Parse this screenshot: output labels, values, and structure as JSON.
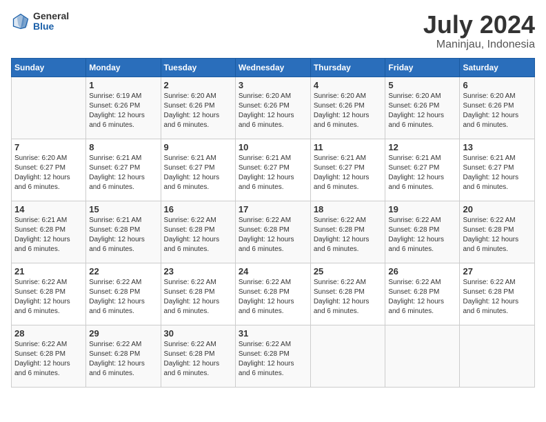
{
  "header": {
    "logo_general": "General",
    "logo_blue": "Blue",
    "month_year": "July 2024",
    "location": "Maninjau, Indonesia"
  },
  "days_of_week": [
    "Sunday",
    "Monday",
    "Tuesday",
    "Wednesday",
    "Thursday",
    "Friday",
    "Saturday"
  ],
  "weeks": [
    [
      {
        "day": "",
        "info": ""
      },
      {
        "day": "1",
        "info": "Sunrise: 6:19 AM\nSunset: 6:26 PM\nDaylight: 12 hours\nand 6 minutes."
      },
      {
        "day": "2",
        "info": "Sunrise: 6:20 AM\nSunset: 6:26 PM\nDaylight: 12 hours\nand 6 minutes."
      },
      {
        "day": "3",
        "info": "Sunrise: 6:20 AM\nSunset: 6:26 PM\nDaylight: 12 hours\nand 6 minutes."
      },
      {
        "day": "4",
        "info": "Sunrise: 6:20 AM\nSunset: 6:26 PM\nDaylight: 12 hours\nand 6 minutes."
      },
      {
        "day": "5",
        "info": "Sunrise: 6:20 AM\nSunset: 6:26 PM\nDaylight: 12 hours\nand 6 minutes."
      },
      {
        "day": "6",
        "info": "Sunrise: 6:20 AM\nSunset: 6:26 PM\nDaylight: 12 hours\nand 6 minutes."
      }
    ],
    [
      {
        "day": "7",
        "info": "Sunrise: 6:20 AM\nSunset: 6:27 PM\nDaylight: 12 hours\nand 6 minutes."
      },
      {
        "day": "8",
        "info": "Sunrise: 6:21 AM\nSunset: 6:27 PM\nDaylight: 12 hours\nand 6 minutes."
      },
      {
        "day": "9",
        "info": "Sunrise: 6:21 AM\nSunset: 6:27 PM\nDaylight: 12 hours\nand 6 minutes."
      },
      {
        "day": "10",
        "info": "Sunrise: 6:21 AM\nSunset: 6:27 PM\nDaylight: 12 hours\nand 6 minutes."
      },
      {
        "day": "11",
        "info": "Sunrise: 6:21 AM\nSunset: 6:27 PM\nDaylight: 12 hours\nand 6 minutes."
      },
      {
        "day": "12",
        "info": "Sunrise: 6:21 AM\nSunset: 6:27 PM\nDaylight: 12 hours\nand 6 minutes."
      },
      {
        "day": "13",
        "info": "Sunrise: 6:21 AM\nSunset: 6:27 PM\nDaylight: 12 hours\nand 6 minutes."
      }
    ],
    [
      {
        "day": "14",
        "info": "Sunrise: 6:21 AM\nSunset: 6:28 PM\nDaylight: 12 hours\nand 6 minutes."
      },
      {
        "day": "15",
        "info": "Sunrise: 6:21 AM\nSunset: 6:28 PM\nDaylight: 12 hours\nand 6 minutes."
      },
      {
        "day": "16",
        "info": "Sunrise: 6:22 AM\nSunset: 6:28 PM\nDaylight: 12 hours\nand 6 minutes."
      },
      {
        "day": "17",
        "info": "Sunrise: 6:22 AM\nSunset: 6:28 PM\nDaylight: 12 hours\nand 6 minutes."
      },
      {
        "day": "18",
        "info": "Sunrise: 6:22 AM\nSunset: 6:28 PM\nDaylight: 12 hours\nand 6 minutes."
      },
      {
        "day": "19",
        "info": "Sunrise: 6:22 AM\nSunset: 6:28 PM\nDaylight: 12 hours\nand 6 minutes."
      },
      {
        "day": "20",
        "info": "Sunrise: 6:22 AM\nSunset: 6:28 PM\nDaylight: 12 hours\nand 6 minutes."
      }
    ],
    [
      {
        "day": "21",
        "info": "Sunrise: 6:22 AM\nSunset: 6:28 PM\nDaylight: 12 hours\nand 6 minutes."
      },
      {
        "day": "22",
        "info": "Sunrise: 6:22 AM\nSunset: 6:28 PM\nDaylight: 12 hours\nand 6 minutes."
      },
      {
        "day": "23",
        "info": "Sunrise: 6:22 AM\nSunset: 6:28 PM\nDaylight: 12 hours\nand 6 minutes."
      },
      {
        "day": "24",
        "info": "Sunrise: 6:22 AM\nSunset: 6:28 PM\nDaylight: 12 hours\nand 6 minutes."
      },
      {
        "day": "25",
        "info": "Sunrise: 6:22 AM\nSunset: 6:28 PM\nDaylight: 12 hours\nand 6 minutes."
      },
      {
        "day": "26",
        "info": "Sunrise: 6:22 AM\nSunset: 6:28 PM\nDaylight: 12 hours\nand 6 minutes."
      },
      {
        "day": "27",
        "info": "Sunrise: 6:22 AM\nSunset: 6:28 PM\nDaylight: 12 hours\nand 6 minutes."
      }
    ],
    [
      {
        "day": "28",
        "info": "Sunrise: 6:22 AM\nSunset: 6:28 PM\nDaylight: 12 hours\nand 6 minutes."
      },
      {
        "day": "29",
        "info": "Sunrise: 6:22 AM\nSunset: 6:28 PM\nDaylight: 12 hours\nand 6 minutes."
      },
      {
        "day": "30",
        "info": "Sunrise: 6:22 AM\nSunset: 6:28 PM\nDaylight: 12 hours\nand 6 minutes."
      },
      {
        "day": "31",
        "info": "Sunrise: 6:22 AM\nSunset: 6:28 PM\nDaylight: 12 hours\nand 6 minutes."
      },
      {
        "day": "",
        "info": ""
      },
      {
        "day": "",
        "info": ""
      },
      {
        "day": "",
        "info": ""
      }
    ]
  ]
}
